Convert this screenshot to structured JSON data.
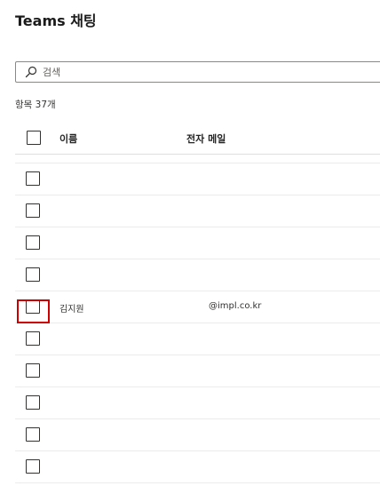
{
  "page": {
    "title": "Teams 채팅"
  },
  "search": {
    "placeholder": "검색",
    "value": ""
  },
  "list": {
    "count_label": "항목 37개",
    "columns": {
      "name": "이름",
      "email": "전자 메일"
    },
    "rows": [
      {
        "name": "",
        "email": ""
      },
      {
        "name": "",
        "email": ""
      },
      {
        "name": "",
        "email": ""
      },
      {
        "name": "",
        "email": ""
      },
      {
        "name": "",
        "email": ""
      },
      {
        "name": "김지원",
        "email": "@impl.co.kr"
      },
      {
        "name": "",
        "email": ""
      },
      {
        "name": "",
        "email": ""
      },
      {
        "name": "",
        "email": ""
      },
      {
        "name": "",
        "email": ""
      },
      {
        "name": "",
        "email": ""
      }
    ]
  },
  "colors": {
    "highlight": "#d00000",
    "border": "#8a8886",
    "divider": "#edebe9"
  },
  "icons": {
    "search": "search-icon"
  }
}
